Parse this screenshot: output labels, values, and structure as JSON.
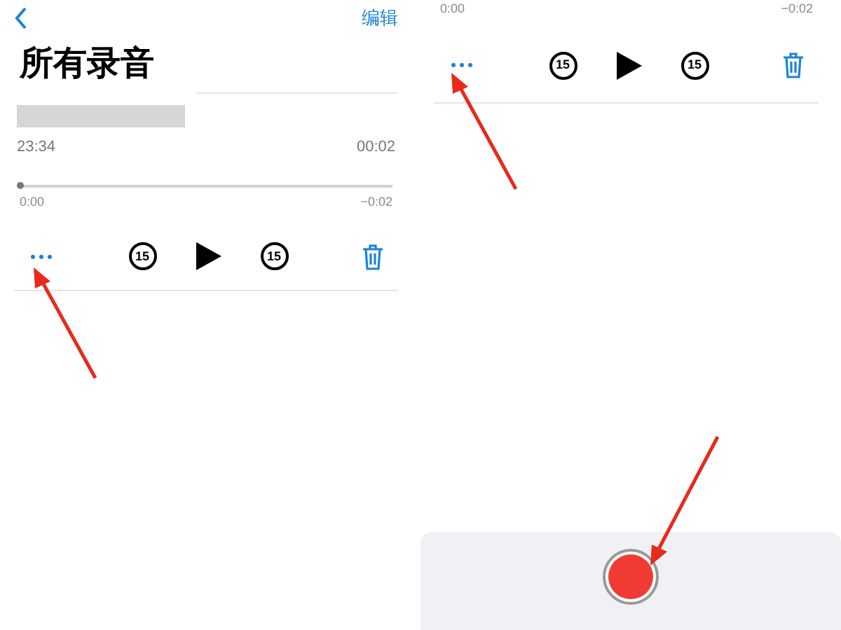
{
  "left_screen": {
    "edit_link": "编辑",
    "title": "所有录音",
    "recording": {
      "date": "23:34",
      "duration": "00:02"
    },
    "player": {
      "level": 0,
      "elapsed": "0:00",
      "remaining": "−0:02",
      "skip_back": "15",
      "skip_forward": "15"
    }
  },
  "right_screen": {
    "player": {
      "elapsed": "0:00",
      "remaining": "−0:02",
      "skip_back": "15",
      "skip_forward": "15"
    }
  }
}
